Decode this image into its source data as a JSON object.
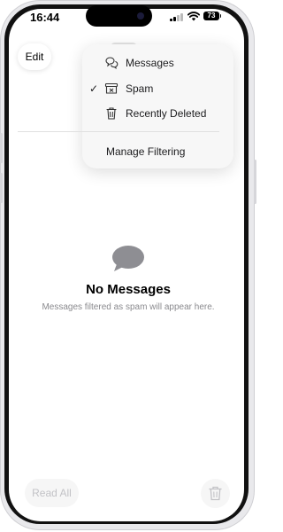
{
  "status_bar": {
    "time": "16:44",
    "battery": "73"
  },
  "toolbar": {
    "edit_label": "Edit"
  },
  "filter_menu": {
    "items": [
      {
        "label": "Messages",
        "icon": "chat-bubbles-icon",
        "checked": false
      },
      {
        "label": "Spam",
        "icon": "spam-tray-icon",
        "checked": true
      },
      {
        "label": "Recently Deleted",
        "icon": "trash-icon",
        "checked": false
      }
    ],
    "check_mark": "✓",
    "manage_label": "Manage Filtering"
  },
  "empty_state": {
    "title": "No Messages",
    "subtitle": "Messages filtered as spam will appear here."
  },
  "bottom_bar": {
    "read_all_label": "Read All"
  }
}
